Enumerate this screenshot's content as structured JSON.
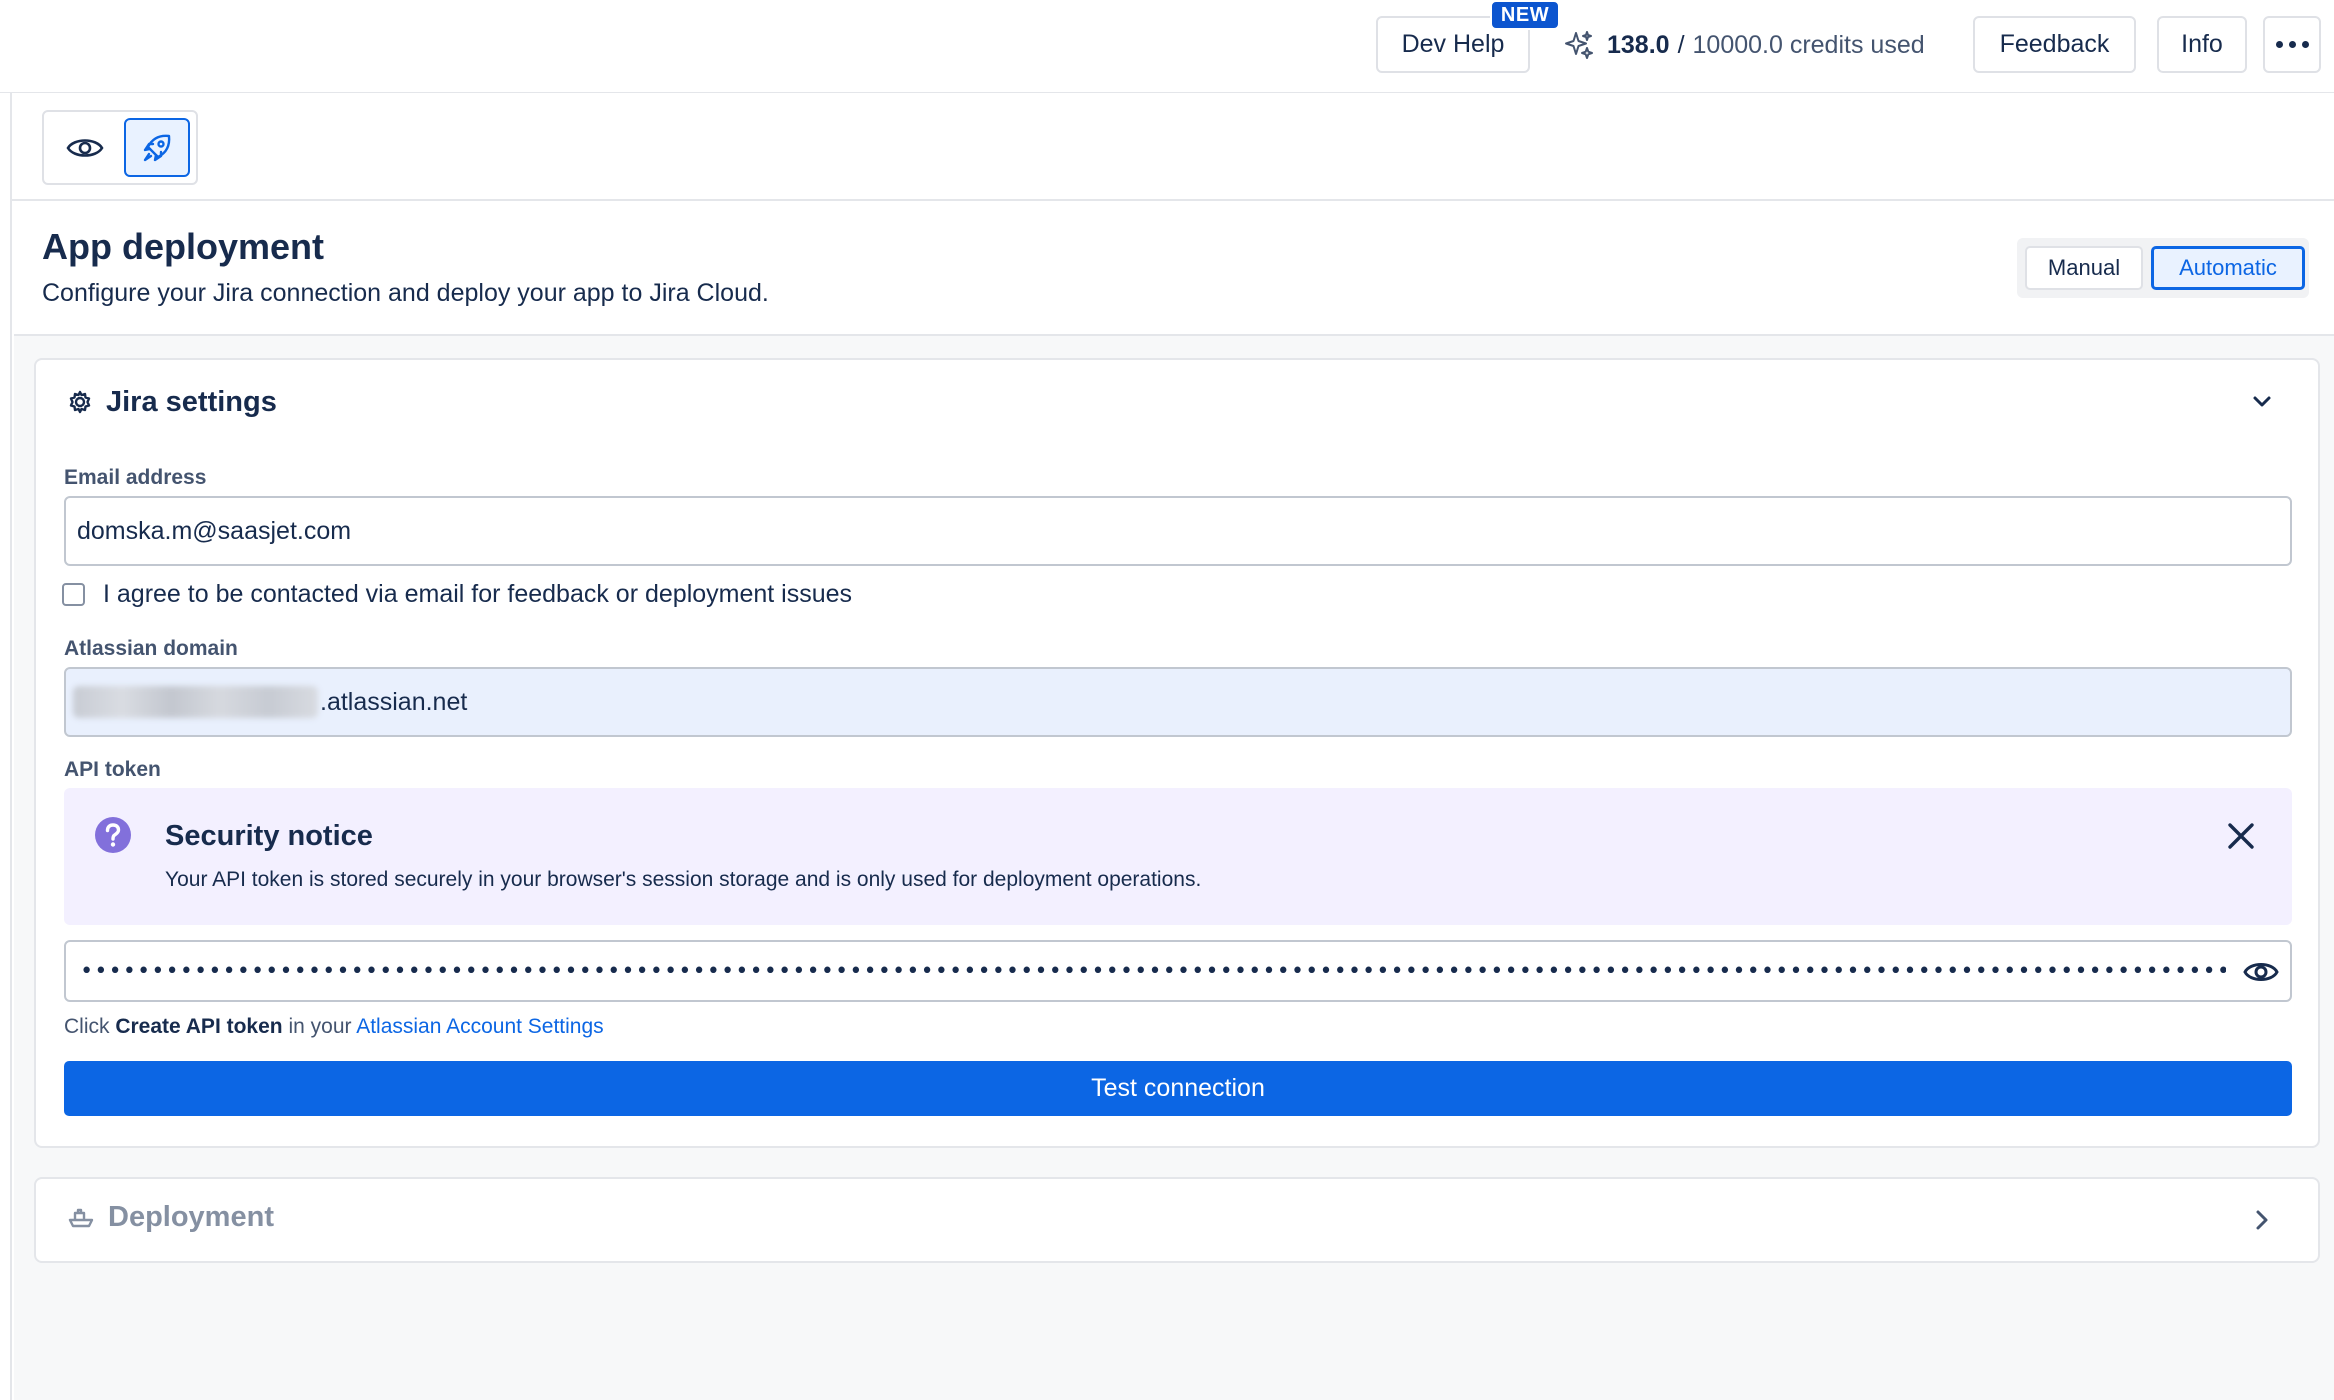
{
  "topbar": {
    "dev_help_label": "Dev Help",
    "new_badge": "NEW",
    "credits_used": "138.0",
    "credits_separator": "/",
    "credits_rest": "10000.0 credits used",
    "feedback_label": "Feedback",
    "info_label": "Info",
    "more_icon": "more-horizontal-icon"
  },
  "toolbar": {
    "view_icon": "eye-icon",
    "deploy_icon": "rocket-icon"
  },
  "page": {
    "title": "App deployment",
    "subtitle": "Configure your Jira connection and deploy your app to Jira Cloud."
  },
  "mode_toggle": {
    "options": [
      "Manual",
      "Automatic"
    ],
    "selected": "Automatic"
  },
  "jira_settings": {
    "title": "Jira settings",
    "expanded": true,
    "email": {
      "label": "Email address",
      "value": "domska.m@saasjet.com"
    },
    "agree_checkbox": {
      "label": "I agree to be contacted via email for feedback or deployment issues",
      "checked": false
    },
    "domain": {
      "label": "Atlassian domain",
      "suffix": ".atlassian.net"
    },
    "api_token": {
      "label": "API token",
      "masked_value": "••••••••••••••••••••••••••••••••••••••••••••••••••••••••••••••••••••••••••••••••••••••••••••••••••••••••••••••••••••••••••••••••••••••••••••••••••••••••••••••••••••••••••••••••••••••••••"
    },
    "security_notice": {
      "title": "Security notice",
      "text": "Your API token is stored securely in your browser's session storage and is only used for deployment operations."
    },
    "helper": {
      "prefix": "Click",
      "bold": "Create API token",
      "middle": "in your",
      "link": "Atlassian Account Settings"
    },
    "test_button": "Test connection"
  },
  "deployment": {
    "title": "Deployment",
    "expanded": false
  },
  "colors": {
    "accent": "#0c66e4",
    "badge": "#0c55cf",
    "notice_bg": "#f3f0ff",
    "notice_icon": "#8270db"
  }
}
